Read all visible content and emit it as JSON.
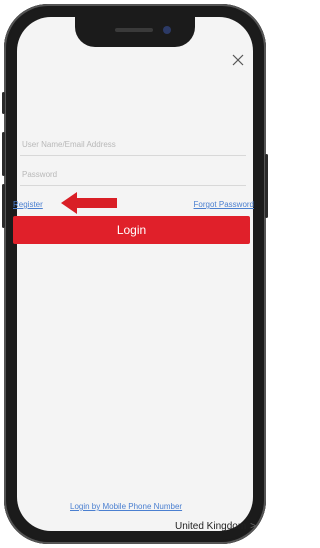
{
  "form": {
    "username_placeholder": "User Name/Email Address",
    "password_placeholder": "Password",
    "register_label": "Register",
    "forgot_label": "Forgot Password",
    "login_label": "Login",
    "mobile_login_label": "Login by Mobile Phone Number"
  },
  "footer": {
    "country": "United Kingdom",
    "chevron": ">"
  },
  "icons": {
    "close": "close-icon",
    "annotation": "red-arrow-icon"
  },
  "colors": {
    "primary": "#e0202a",
    "link": "#4a7fd0",
    "background": "#f4f4f4"
  }
}
